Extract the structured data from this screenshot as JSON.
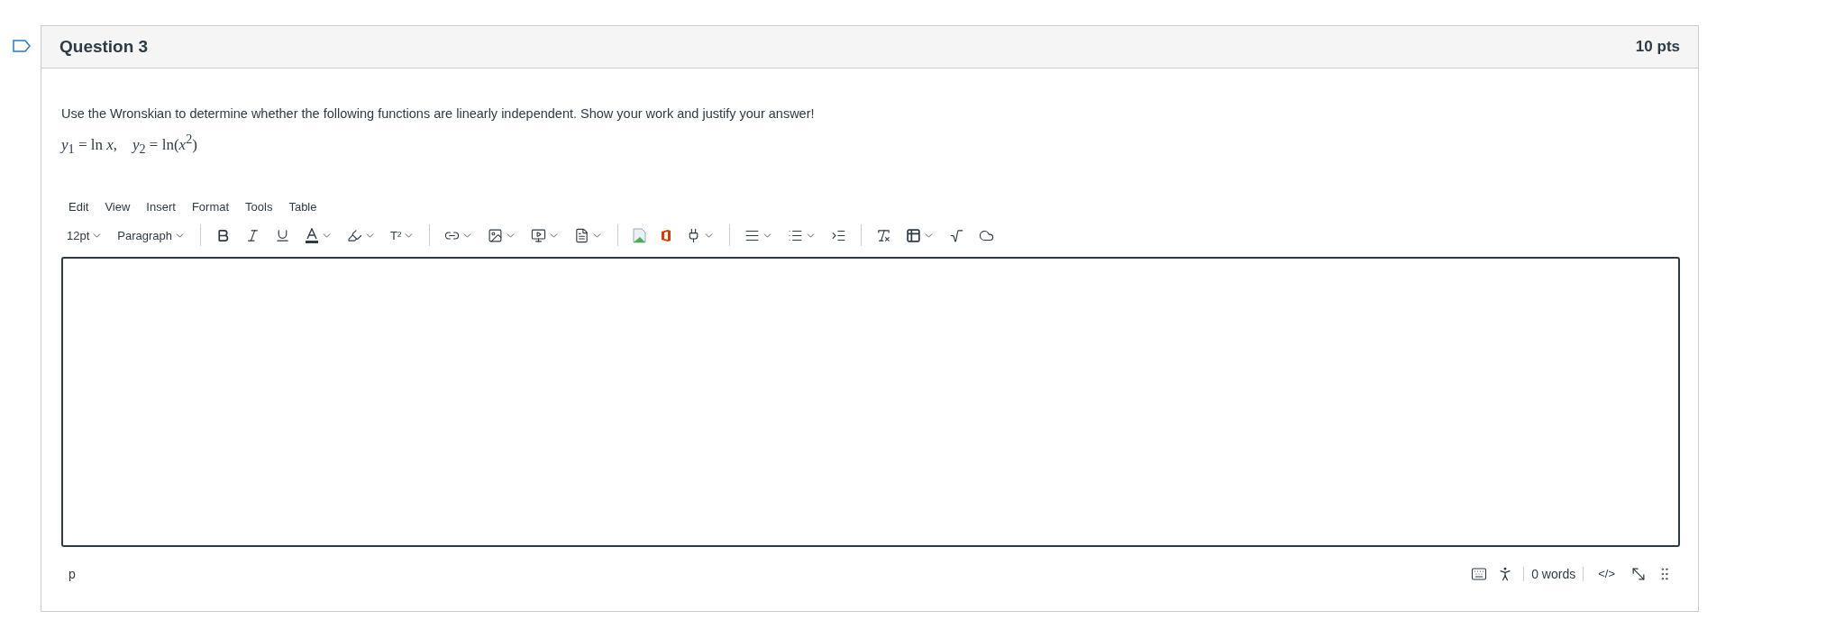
{
  "question": {
    "title": "Question 3",
    "points": "10 pts",
    "prompt": "Use the Wronskian to determine whether the following functions are linearly independent. Show your work and justify your answer!",
    "formula": "*y*$_{1}$ = ln *x*,    *y*$_{2}$ = ln(*x*$^{2}$)"
  },
  "editor": {
    "menus": [
      "Edit",
      "View",
      "Insert",
      "Format",
      "Tools",
      "Table"
    ],
    "font_size": "12pt",
    "block_format": "Paragraph",
    "superscript": "T²",
    "status_bar": {
      "path": "p",
      "word_count": "0 words",
      "html_toggle": "</>"
    }
  }
}
